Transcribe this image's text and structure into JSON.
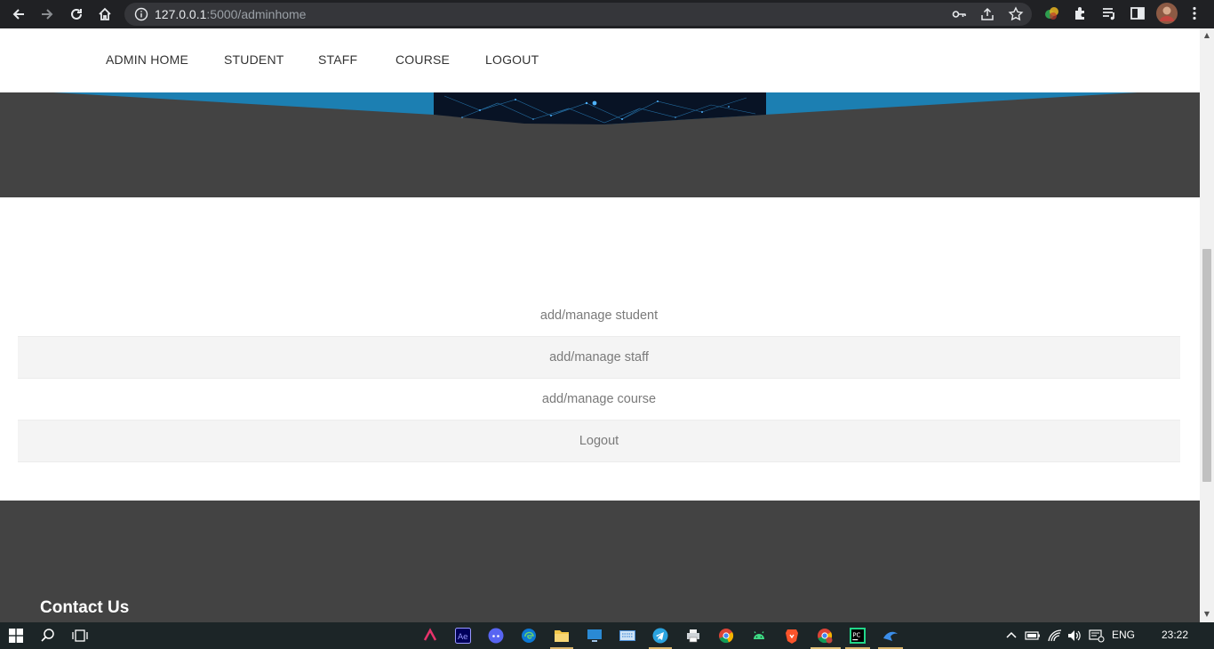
{
  "browser": {
    "url_host": "127.0.0.1",
    "url_path": ":5000/adminhome"
  },
  "nav": {
    "items": [
      {
        "label": "ADMIN HOME"
      },
      {
        "label": "STUDENT"
      },
      {
        "label": "STAFF"
      },
      {
        "label": "COURSE"
      },
      {
        "label": "LOGOUT"
      }
    ]
  },
  "menu": {
    "items": [
      {
        "label": "add/manage student"
      },
      {
        "label": "add/manage staff"
      },
      {
        "label": "add/manage course"
      },
      {
        "label": "Logout"
      }
    ]
  },
  "footer": {
    "heading": "Contact Us"
  },
  "taskbar": {
    "language": "ENG",
    "time": "23:22"
  },
  "colors": {
    "hero_bg": "#434343",
    "hero_blue": "#1c7fb2",
    "footer_bg": "#434343",
    "chrome_bg": "#202124"
  }
}
